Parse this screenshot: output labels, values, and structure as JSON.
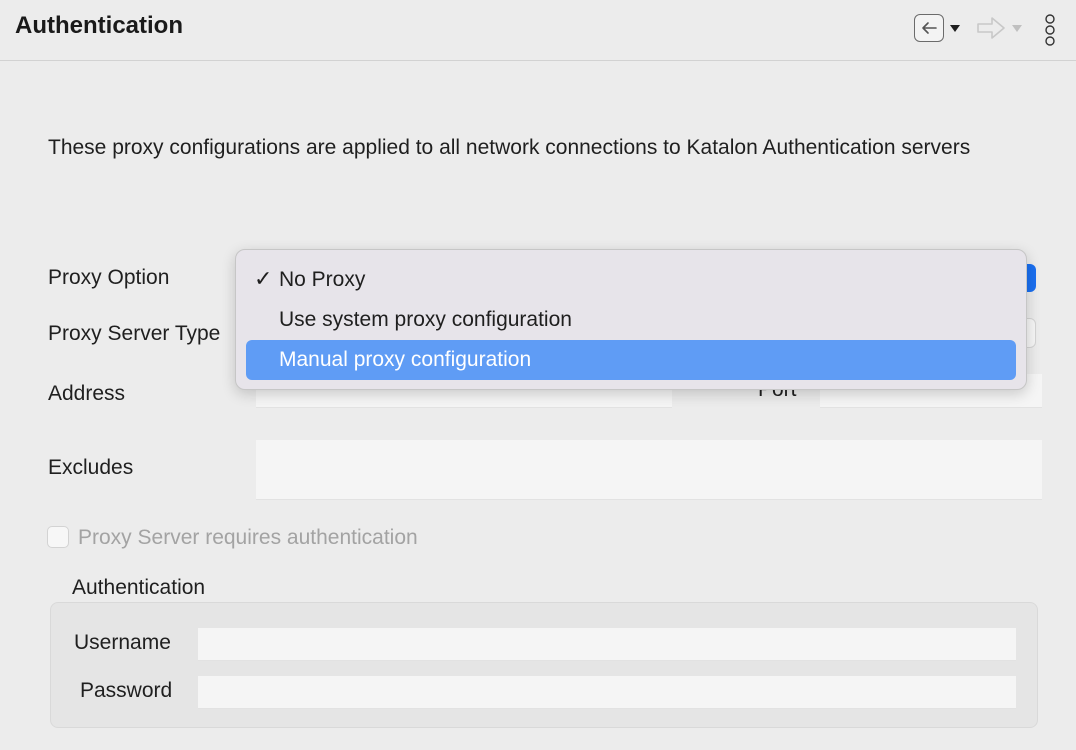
{
  "header": {
    "title": "Authentication",
    "back_icon": "back-arrow-icon",
    "forward_icon": "forward-arrow-icon",
    "more_icon": "kebab-menu-icon"
  },
  "description": "These proxy configurations are applied to all network connections to Katalon Authentication servers",
  "form": {
    "proxy_option_label": "Proxy Option",
    "proxy_server_type_label": "Proxy Server Type",
    "address_label": "Address",
    "port_label": "Port",
    "excludes_label": "Excludes",
    "requires_auth_label": "Proxy Server requires authentication",
    "requires_auth_checked": false
  },
  "auth_group": {
    "title": "Authentication",
    "username_label": "Username",
    "password_label": "Password"
  },
  "dropdown": {
    "items": [
      {
        "label": "No Proxy",
        "checked": true
      },
      {
        "label": "Use system proxy configuration",
        "checked": false
      },
      {
        "label": "Manual proxy configuration",
        "checked": false,
        "highlighted": true
      }
    ],
    "check_glyph": "✓"
  },
  "colors": {
    "accent": "#1a6ff0",
    "menu_highlight": "#5f9cf5",
    "background": "#ececec",
    "disabled_text": "#a3a3a3"
  }
}
